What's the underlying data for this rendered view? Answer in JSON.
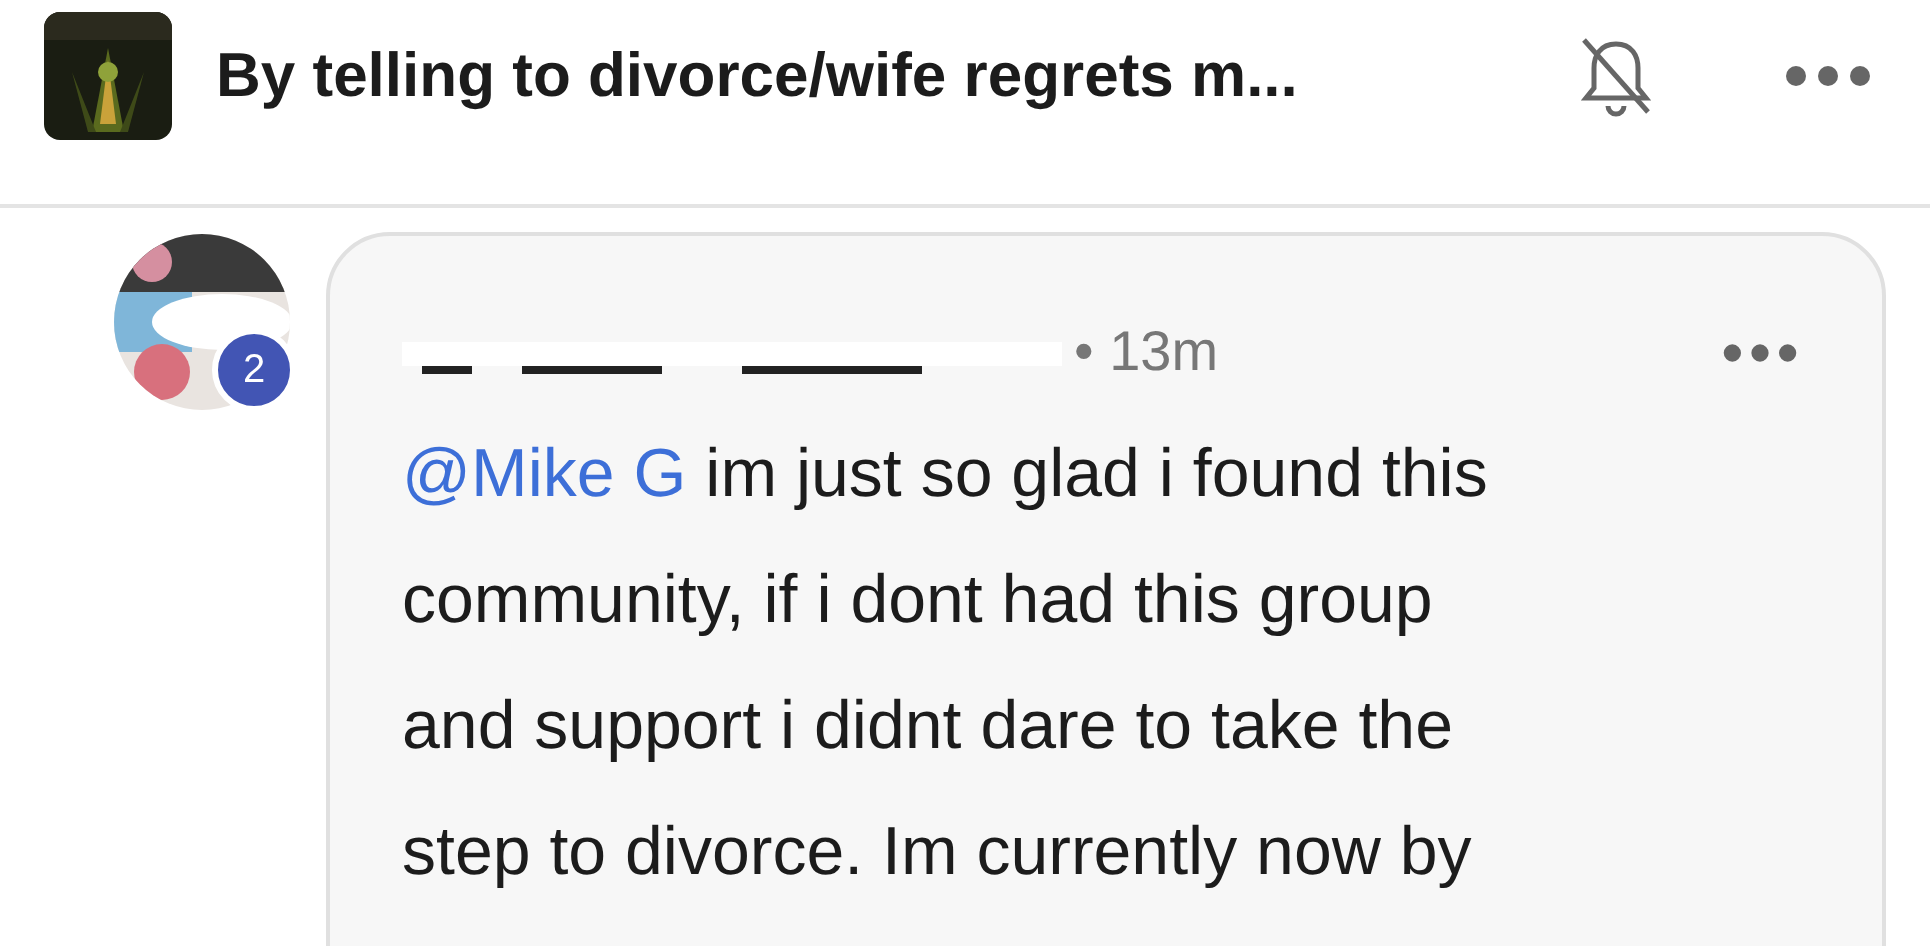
{
  "header": {
    "title": "By telling to divorce/wife regrets m...",
    "notifications_muted": true
  },
  "comment": {
    "badge": "2",
    "time": "13m",
    "separator": "•",
    "mention": "@Mike G",
    "text": " im just so glad i found this\ncommunity, if i dont had this group\nand support i didnt dare to take the\nstep to divorce. Im currently now by"
  }
}
